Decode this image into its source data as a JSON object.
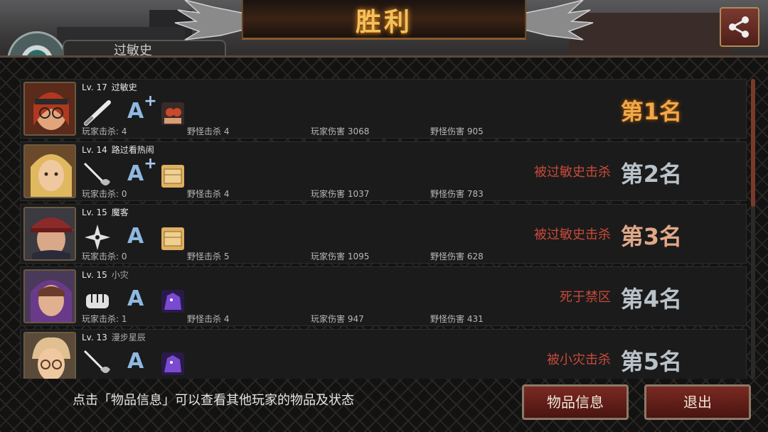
{
  "header": {
    "title": "胜利",
    "tab_text": "过敏史",
    "share_icon": "share-icon"
  },
  "players": [
    {
      "level": "Lv. 17",
      "name": "过敏史",
      "grade": "A",
      "grade_plus": "+",
      "weapon": "bat-icon",
      "pet": "pet-goggles-icon",
      "player_kills": "玩家击杀: 4",
      "monster_kills": "野怪击杀 4",
      "player_damage": "玩家伤害 3068",
      "monster_damage": "野怪伤害 905",
      "result": "",
      "rank": "第1名"
    },
    {
      "level": "Lv. 14",
      "name": "路过看热闹",
      "grade": "A",
      "grade_plus": "+",
      "weapon": "rapier-icon",
      "pet": "pet-box-icon",
      "player_kills": "玩家击杀: 0",
      "monster_kills": "野怪击杀 4",
      "player_damage": "玩家伤害 1037",
      "monster_damage": "野怪伤害 783",
      "result": "被过敏史击杀",
      "rank": "第2名"
    },
    {
      "level": "Lv. 15",
      "name": "魔客",
      "grade": "A",
      "grade_plus": "",
      "weapon": "shuriken-icon",
      "pet": "pet-box-icon",
      "player_kills": "玩家击杀: 0",
      "monster_kills": "野怪击杀 5",
      "player_damage": "玩家伤害 1095",
      "monster_damage": "野怪伤害 628",
      "result": "被过敏史击杀",
      "rank": "第3名"
    },
    {
      "level": "Lv. 15",
      "name": "小灾",
      "grade": "A",
      "grade_plus": "",
      "weapon": "fist-icon",
      "pet": "pet-purple-icon",
      "player_kills": "玩家击杀: 1",
      "monster_kills": "野怪击杀 4",
      "player_damage": "玩家伤害 947",
      "monster_damage": "野怪伤害 431",
      "result": "死于禁区",
      "rank": "第4名"
    },
    {
      "level": "Lv. 13",
      "name": "漫步星辰",
      "grade": "A",
      "grade_plus": "",
      "weapon": "rapier-icon",
      "pet": "pet-purple-icon",
      "player_kills": "",
      "monster_kills": "",
      "player_damage": "",
      "monster_damage": "",
      "result": "被小灾击杀",
      "rank": "第5名"
    }
  ],
  "footer": {
    "hint": "点击「物品信息」可以查看其他玩家的物品及状态",
    "items_button": "物品信息",
    "exit_button": "退出"
  },
  "colors": {
    "title": "#f2c25a",
    "first_rank": "#f0a84a",
    "result_text": "#c84a3a",
    "button_bg": "#7a2a22"
  }
}
